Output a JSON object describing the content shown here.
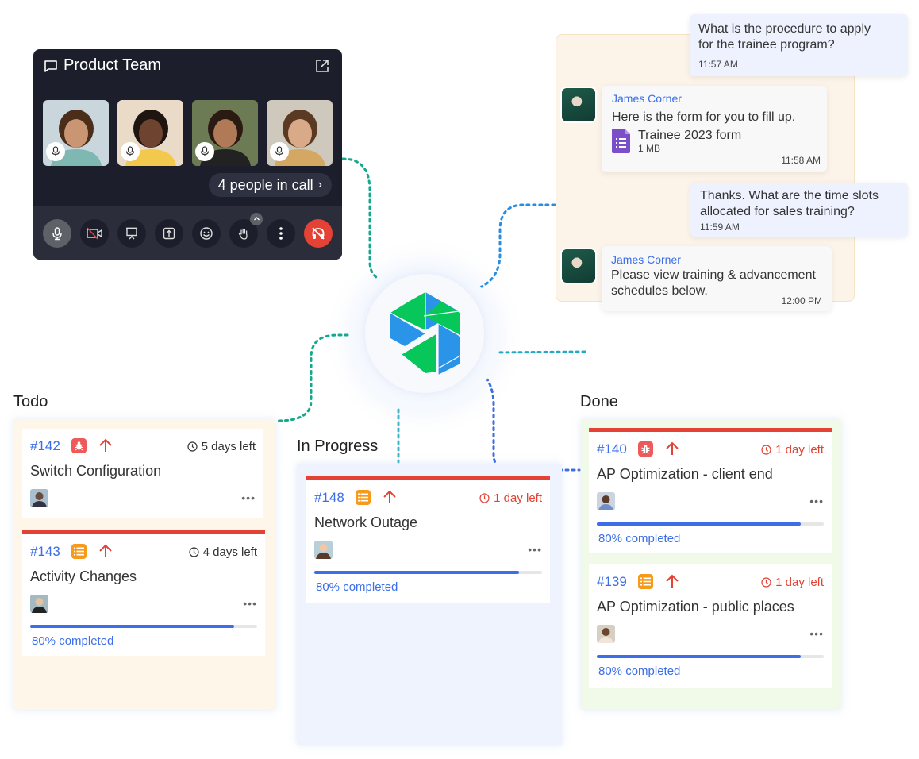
{
  "call": {
    "title": "Product Team",
    "participants": [
      {
        "name": "participant-1",
        "bg": "#c9d6dc",
        "skin": "#c99573",
        "hair": "#4a2e1a"
      },
      {
        "name": "participant-2",
        "bg": "#eadbc9",
        "skin": "#6e4430",
        "hair": "#1e1510"
      },
      {
        "name": "participant-3",
        "bg": "#6d7b55",
        "skin": "#b07a58",
        "hair": "#2b1a12"
      },
      {
        "name": "participant-4",
        "bg": "#cfc8bd",
        "skin": "#d9aa88",
        "hair": "#5a3a22"
      }
    ],
    "people_label": "4 people in call",
    "controls": [
      "microphone",
      "camera-off",
      "present",
      "share-screen",
      "reactions",
      "raise-hand",
      "more",
      "end-call"
    ],
    "end_call_color": "#e34234"
  },
  "chat": {
    "messages": [
      {
        "from": "me",
        "text_line1": "What is the procedure to apply",
        "text_line2": "for the trainee program?",
        "time": "11:57 AM"
      },
      {
        "from": "them",
        "sender": "James Corner",
        "text": "Here is the form for you to fill up.",
        "file": {
          "name": "Trainee 2023 form",
          "size": "1 MB"
        },
        "time": "11:58 AM"
      },
      {
        "from": "me",
        "text_line1": "Thanks. What are the time slots",
        "text_line2": "allocated for sales training?",
        "time": "11:59 AM"
      },
      {
        "from": "them",
        "sender": "James Corner",
        "text_line1": "Please view training & advancement",
        "text_line2": "schedules below.",
        "time": "12:00 PM"
      }
    ]
  },
  "board": {
    "columns": [
      {
        "title": "Todo",
        "cards": [
          {
            "id": "#142",
            "type": "bug",
            "priority": "high",
            "due": "5 days left",
            "urgent": false,
            "title": "Switch Configuration",
            "progress": null
          },
          {
            "id": "#143",
            "type": "task",
            "priority": "high",
            "due": "4 days left",
            "urgent": false,
            "title": "Activity Changes",
            "progress": 0.8,
            "progress_label": "80% completed"
          }
        ]
      },
      {
        "title": "In Progress",
        "cards": [
          {
            "id": "#148",
            "type": "task",
            "priority": "high",
            "due": "1 day left",
            "urgent": true,
            "title": "Network Outage",
            "progress": 0.8,
            "progress_label": "80% completed"
          }
        ]
      },
      {
        "title": "Done",
        "cards": [
          {
            "id": "#140",
            "type": "bug",
            "priority": "high",
            "due": "1 day left",
            "urgent": true,
            "title": "AP Optimization - client end",
            "progress": 0.8,
            "progress_label": "80% completed"
          },
          {
            "id": "#139",
            "type": "task",
            "priority": "high",
            "due": "1 day left",
            "urgent": true,
            "title": "AP Optimization - public places",
            "progress": 0.8,
            "progress_label": "80% completed"
          }
        ]
      }
    ],
    "more_label": "•••"
  },
  "colors": {
    "accent_blue": "#3b6ee8",
    "urgent_red": "#e34234",
    "bug": "#ee5a5a",
    "task": "#f79a1a",
    "logo_green": "#07c65a",
    "logo_blue": "#2a94e8"
  }
}
